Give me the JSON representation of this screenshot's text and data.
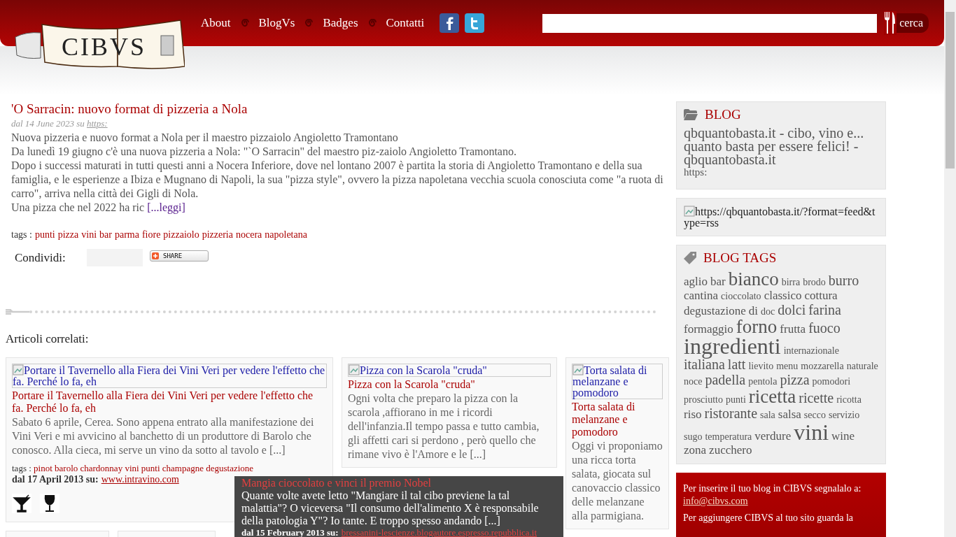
{
  "header": {
    "logo": {
      "text": "CIBVS"
    },
    "nav": [
      {
        "label": "About"
      },
      {
        "label": "BlogVs"
      },
      {
        "label": "Badges"
      },
      {
        "label": "Contatti"
      }
    ],
    "search": {
      "button": "cerca"
    }
  },
  "article": {
    "title": "'O Sarracin: nuovo format di pizzeria a Nola",
    "meta": "dal 14 June 2023 su",
    "meta_link": "https:",
    "paragraphs": [
      "Nuova pizzeria e nuovo format a Nola per il maestro pizzaiolo Angioletto Tramontano",
      "Da lunedì 19 giugno c'è una nuova pizzeria a Nola: \"`O Sarracin\" del maestro piz-zaiolo Angioletto Tramontano.",
      "Dopo i successi maturati in tutti questi anni a Nocera Inferiore, dove nel lontano 2007 è partita la storia di Angioletto Tramontano e della sua famiglia, e le esperienze a Ibiza e Mugnano di Napoli, la sua \"pizza style\", ovvero la pizza napoletana vecchia scuola conosciuta come \"a ruota di carro\", arriva nella città dei Gigli di Nola."
    ],
    "last_line": "Una pizza che nel 2022 ha ric",
    "read_more": "[...leggi]",
    "tags_label": "tags :",
    "tags": [
      "punti",
      "pizza",
      "vini",
      "bar",
      "parma",
      "fiore",
      "pizzaiolo",
      "pizzeria",
      "nocera",
      "napoletana"
    ],
    "share_label": "Condividi:",
    "share_button": "SHARE"
  },
  "related": {
    "heading": "Articoli correlati:",
    "cards": [
      {
        "image_alt": "Portare il Tavernello alla Fiera dei Vini Veri per vedere l'effetto che fa. Perché lo fa, eh",
        "title": "Portare il Tavernello alla Fiera dei Vini Veri per vedere l'effetto che fa. Perché lo fa, eh",
        "excerpt": "Sabato 6 aprile, Cerea. Sono appena entrato alla manifestazione dei Vini Veri e mi avvicino al banchetto di un produttore di Barolo che conosco. Alla cieca, mi serve un vino da sotto al tavolo e [...]",
        "tags_label": "tags :",
        "tags": "pinot barolo chardonnay vini punti champagne degustazione",
        "date": "dal 17 April 2013 su:",
        "source": "www.intravino.com",
        "icons": [
          {
            "kind": "cocktail"
          },
          {
            "kind": "wine"
          }
        ]
      },
      {
        "image_alt": "Pizza con la Scarola \"cruda\"",
        "title": "Pizza con la Scarola \"cruda\"",
        "excerpt": "Ogni volta che preparo la pizza con la scarola ,affiorano in me i ricordi dell'infanzia.Il tempo passa e tutto cambia, gli affetti cari si perdono , però quello che rimane vivo è l'Amore e le [...]"
      },
      {
        "image_alt": "Torta salata di melanzane e pomodoro",
        "title": "Torta salata di melanzane e pomodoro",
        "excerpt": "Oggi vi proponiamo una ricca torta salata, giocata sul canovaccio classico delle melanzane alla parmigiana."
      }
    ],
    "popup": {
      "title": "Mangia cioccolato e vinci il premio Nobel",
      "excerpt": "Quante volte avete letto \"Mangiare il tal cibo previene la tal malattia\"? O viceversa \"Il consumo dell'alimento X è responsabile della patologia Y\"? Io tante. E troppo spesso andando [...]",
      "date": "dal 15 February 2013 su:",
      "source": "bressanini-lescienze.blogautore.espresso.repubblica.it"
    }
  },
  "sidebar": {
    "blog": {
      "title": "BLOG",
      "name": "qbquantobasta.it - cibo, vino e... quanto basta per essere felici! - qbquantobasta.it",
      "url": "https:"
    },
    "feed": {
      "image_alt": "https://qbquantobasta.it/?format=feed&type=rss"
    },
    "tags": {
      "title": "BLOG TAGS",
      "items": [
        {
          "label": "aglio",
          "kind": "medium"
        },
        {
          "label": "bar",
          "kind": "medium"
        },
        {
          "label": "bianco",
          "kind": "huge"
        },
        {
          "label": "birra",
          "kind": "small"
        },
        {
          "label": "brodo",
          "kind": "small"
        },
        {
          "label": "burro",
          "kind": "large"
        },
        {
          "label": "cantina",
          "kind": "medium"
        },
        {
          "label": "cioccolato",
          "kind": "small"
        },
        {
          "label": "classico",
          "kind": "medium"
        },
        {
          "label": "cottura",
          "kind": "medium"
        },
        {
          "label": "degustazione",
          "kind": "medium"
        },
        {
          "label": "di",
          "kind": "medium"
        },
        {
          "label": "doc",
          "kind": "small"
        },
        {
          "label": "dolci",
          "kind": "large"
        },
        {
          "label": "farina",
          "kind": "large"
        },
        {
          "label": "formaggio",
          "kind": "medium"
        },
        {
          "label": "forno",
          "kind": "huge"
        },
        {
          "label": "frutta",
          "kind": "medium"
        },
        {
          "label": "fuoco",
          "kind": "large"
        },
        {
          "label": "ingredienti",
          "kind": "giant"
        },
        {
          "label": "internazionale",
          "kind": "small"
        },
        {
          "label": "italiana",
          "kind": "large"
        },
        {
          "label": "latt",
          "kind": "large"
        },
        {
          "label": "lievito",
          "kind": "small"
        },
        {
          "label": "menu",
          "kind": "small"
        },
        {
          "label": "mozzarella",
          "kind": "small"
        },
        {
          "label": "naturale",
          "kind": "small"
        },
        {
          "label": "noce",
          "kind": "small"
        },
        {
          "label": "padella",
          "kind": "large"
        },
        {
          "label": "pentola",
          "kind": "small"
        },
        {
          "label": "pizza",
          "kind": "large"
        },
        {
          "label": "pomodori",
          "kind": "small"
        },
        {
          "label": "prosciutto",
          "kind": "small"
        },
        {
          "label": "punti",
          "kind": "small"
        },
        {
          "label": "ricetta",
          "kind": "huge"
        },
        {
          "label": "ricette",
          "kind": "large"
        },
        {
          "label": "ricotta",
          "kind": "small"
        },
        {
          "label": "riso",
          "kind": "medium"
        },
        {
          "label": "ristorante",
          "kind": "large"
        },
        {
          "label": "sala",
          "kind": "small"
        },
        {
          "label": "salsa",
          "kind": "medium"
        },
        {
          "label": "secco",
          "kind": "small"
        },
        {
          "label": "servizio",
          "kind": "small"
        },
        {
          "label": "sugo",
          "kind": "small"
        },
        {
          "label": "temperatura",
          "kind": "small"
        },
        {
          "label": "verdure",
          "kind": "medium"
        },
        {
          "label": "vini",
          "kind": "giant"
        },
        {
          "label": "wine",
          "kind": "medium"
        },
        {
          "label": "zona",
          "kind": "medium"
        },
        {
          "label": "zucchero",
          "kind": "medium"
        }
      ]
    },
    "promo": {
      "text": "Per inserire il tuo blog in CIBVS segnalalo a:",
      "email": "info@cibvs.com",
      "text2": "Per aggiungere CIBVS al tuo sito guarda la"
    }
  }
}
